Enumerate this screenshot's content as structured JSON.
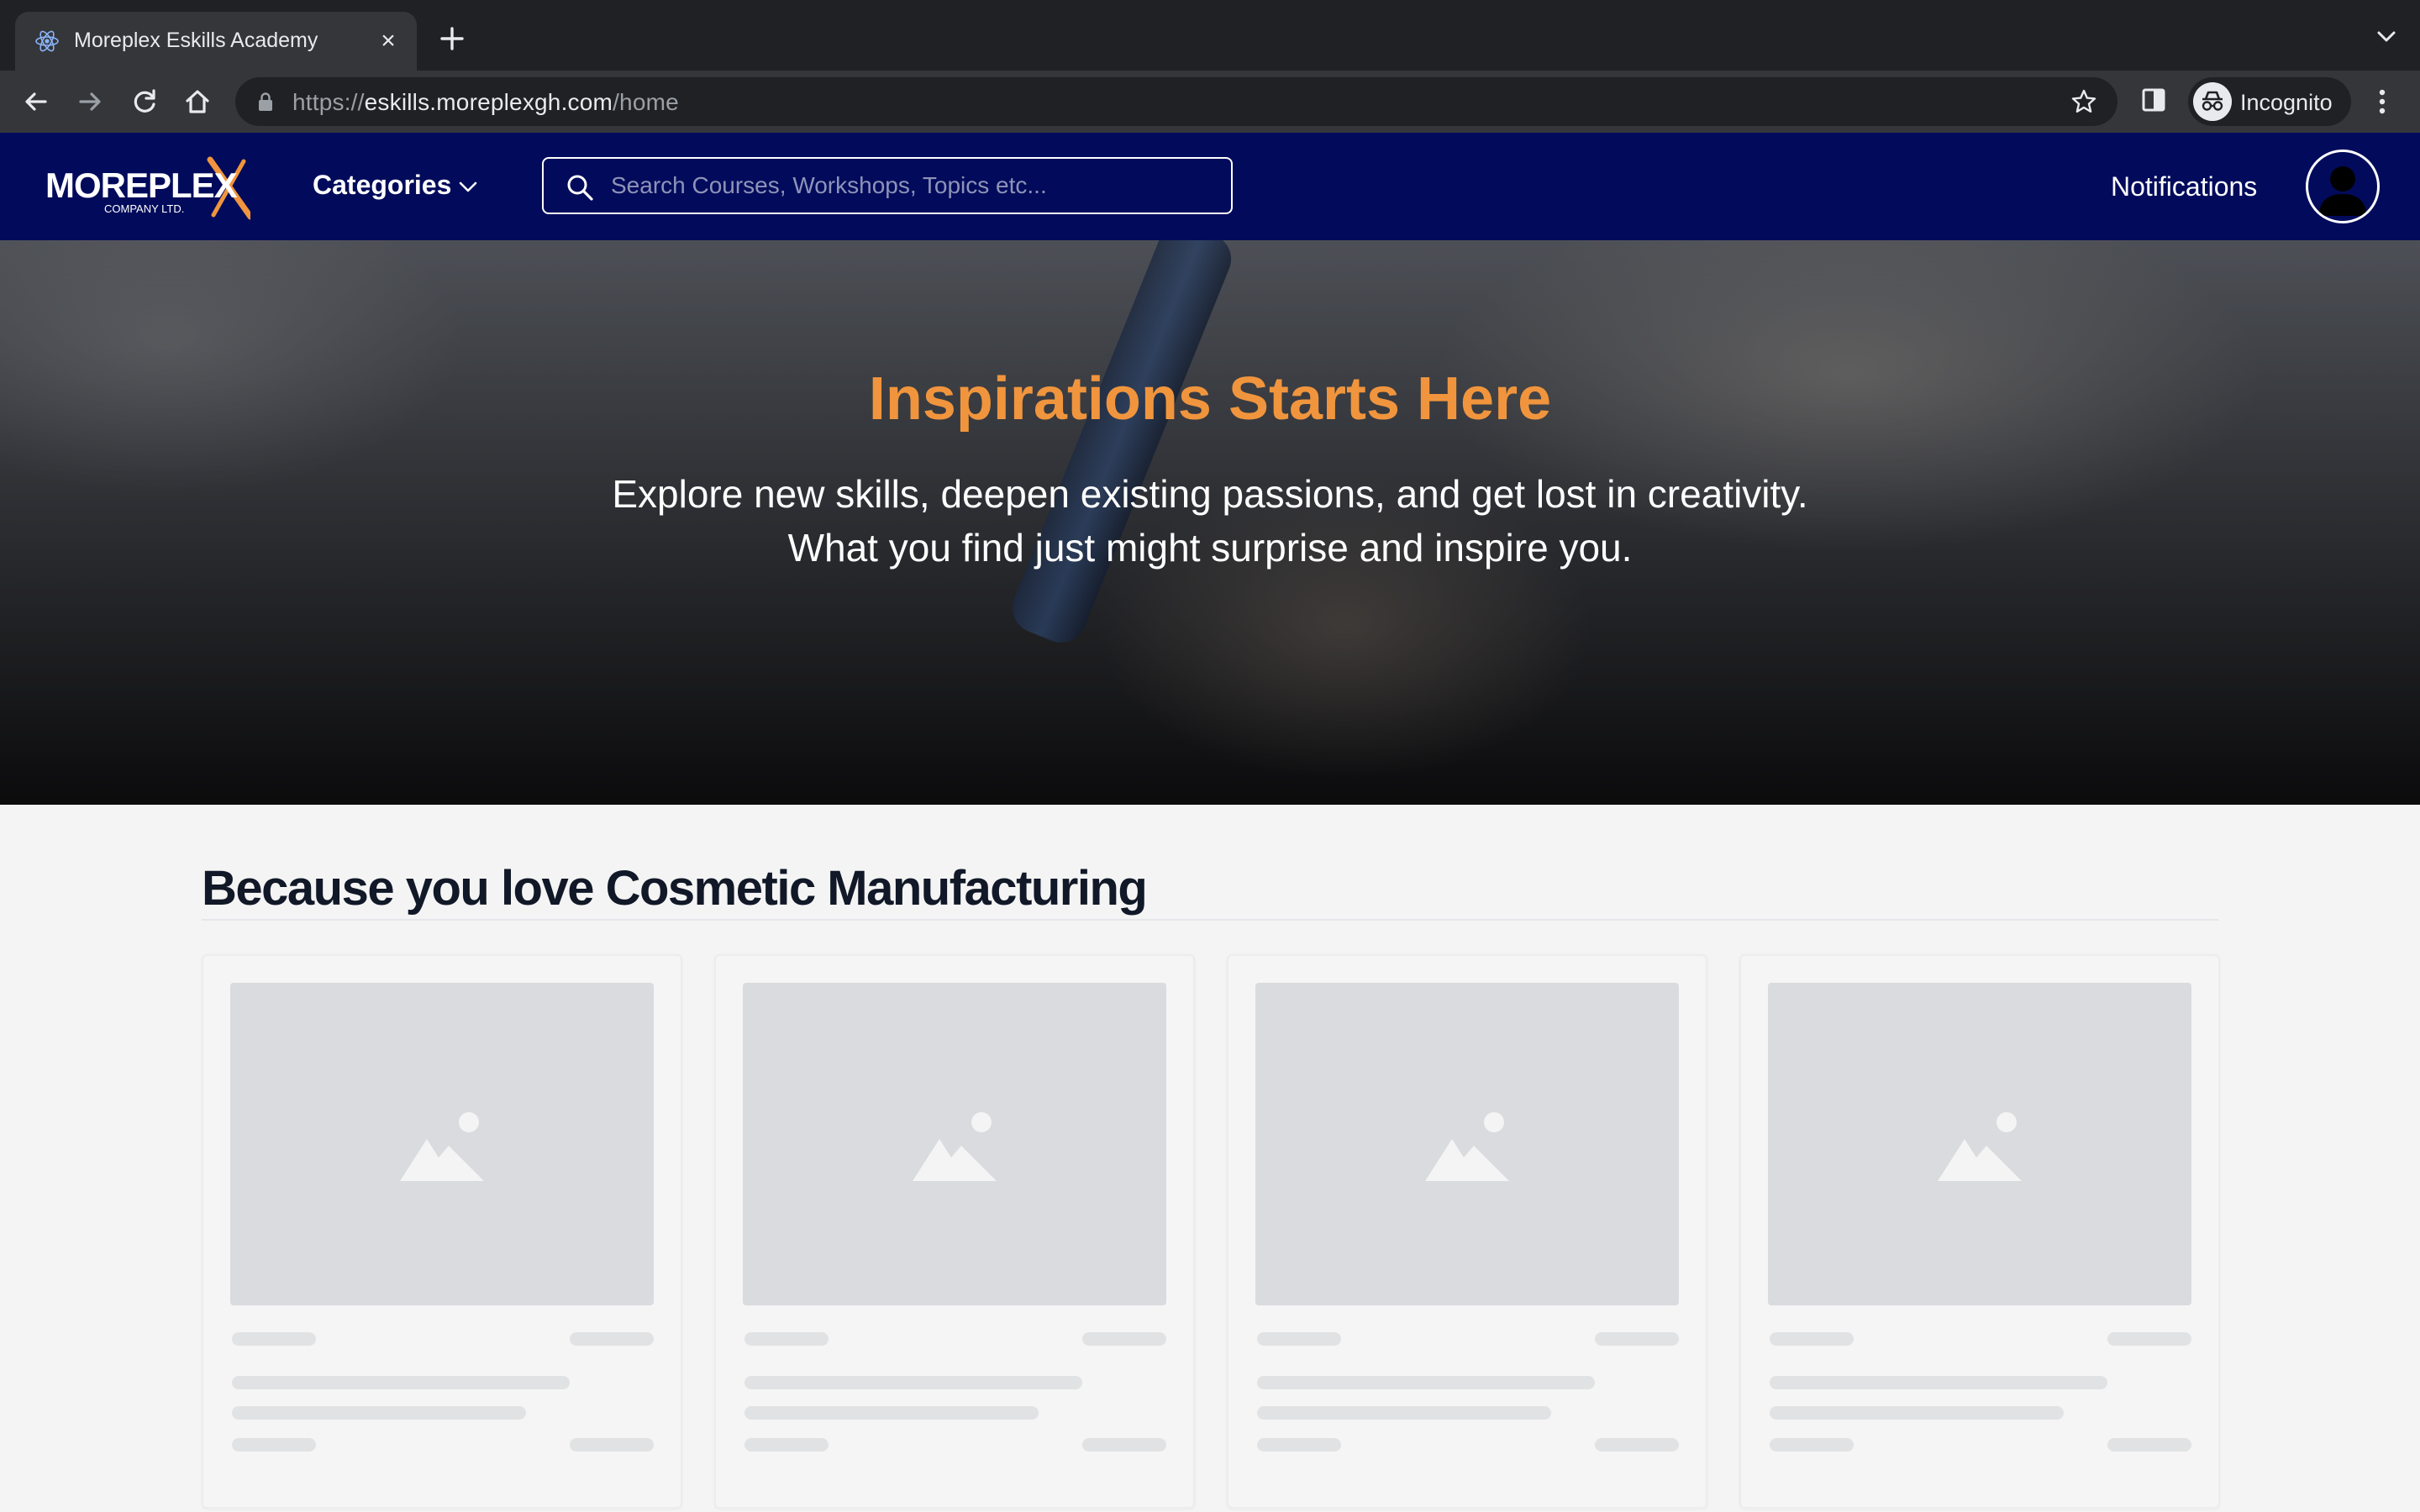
{
  "browser": {
    "tab_title": "Moreplex Eskills Academy",
    "url_scheme": "https://",
    "url_host": "eskills.moreplexgh.com",
    "url_path": "/home",
    "profile_label": "Incognito"
  },
  "site": {
    "logo_text": "MOREPLEX",
    "logo_subtext": "COMPANY LTD.",
    "categories_label": "Categories",
    "search_placeholder": "Search Courses, Workshops, Topics etc...",
    "notifications_label": "Notifications"
  },
  "hero": {
    "title": "Inspirations Starts Here",
    "subtitle_line1": "Explore new skills, deepen existing passions, and get lost in creativity.",
    "subtitle_line2": "What you find just might surprise and inspire you."
  },
  "section": {
    "title": "Because you love Cosmetic Manufacturing"
  },
  "colors": {
    "nav_bg": "#020b5b",
    "hero_title": "#f0953d",
    "skeleton": "#d9dbde"
  },
  "icons": [
    "react-favicon-icon",
    "close-icon",
    "plus-icon",
    "chevron-down-icon",
    "back-arrow-icon",
    "forward-arrow-icon",
    "reload-icon",
    "home-icon",
    "lock-icon",
    "star-icon",
    "side-panel-icon",
    "incognito-icon",
    "menu-dots-icon",
    "search-icon",
    "avatar-icon",
    "image-placeholder-icon"
  ]
}
